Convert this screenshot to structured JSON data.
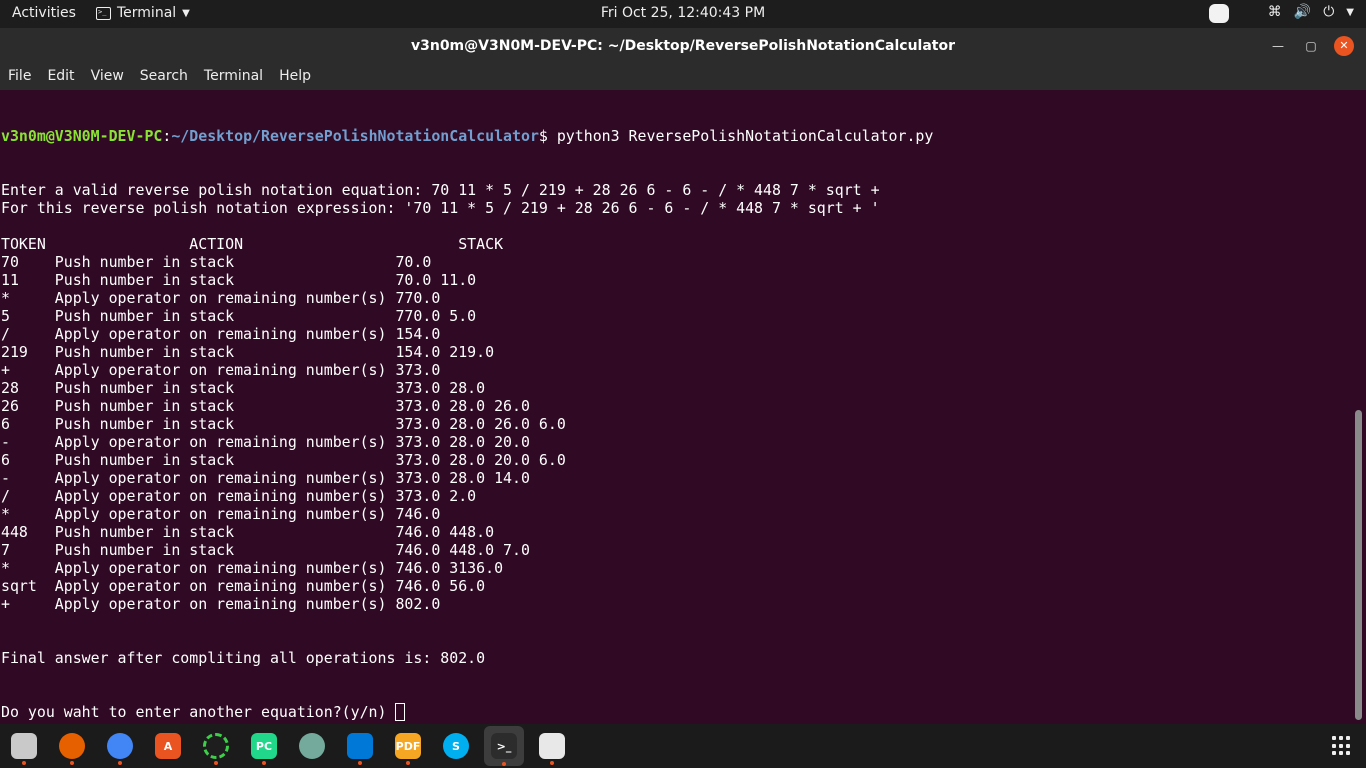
{
  "topbar": {
    "activities": "Activities",
    "app_name": "Terminal",
    "clock": "Fri Oct 25, 12:40:43 PM"
  },
  "window": {
    "title": "v3n0m@V3N0M-DEV-PC: ~/Desktop/ReversePolishNotationCalculator"
  },
  "menubar": [
    "File",
    "Edit",
    "View",
    "Search",
    "Terminal",
    "Help"
  ],
  "terminal": {
    "prompt_user": "v3n0m@V3N0M-DEV-PC",
    "prompt_path": "~/Desktop/ReversePolishNotationCalculator",
    "command": "$ python3 ReversePolishNotationCalculator.py",
    "output": [
      "Enter a valid reverse polish notation equation: 70 11 * 5 / 219 + 28 26 6 - 6 - / * 448 7 * sqrt +",
      "For this reverse polish notation expression: '70 11 * 5 / 219 + 28 26 6 - 6 - / * 448 7 * sqrt + '",
      "",
      "TOKEN                ACTION                        STACK",
      "70    Push number in stack                  70.0",
      "11    Push number in stack                  70.0 11.0",
      "*     Apply operator on remaining number(s) 770.0",
      "5     Push number in stack                  770.0 5.0",
      "/     Apply operator on remaining number(s) 154.0",
      "219   Push number in stack                  154.0 219.0",
      "+     Apply operator on remaining number(s) 373.0",
      "28    Push number in stack                  373.0 28.0",
      "26    Push number in stack                  373.0 28.0 26.0",
      "6     Push number in stack                  373.0 28.0 26.0 6.0",
      "-     Apply operator on remaining number(s) 373.0 28.0 20.0",
      "6     Push number in stack                  373.0 28.0 20.0 6.0",
      "-     Apply operator on remaining number(s) 373.0 28.0 14.0",
      "/     Apply operator on remaining number(s) 373.0 2.0",
      "*     Apply operator on remaining number(s) 746.0",
      "448   Push number in stack                  746.0 448.0",
      "7     Push number in stack                  746.0 448.0 7.0",
      "*     Apply operator on remaining number(s) 746.0 3136.0",
      "sqrt  Apply operator on remaining number(s) 746.0 56.0",
      "+     Apply operator on remaining number(s) 802.0",
      "",
      "",
      "Final answer after compliting all operations is: 802.0",
      "",
      "",
      "Do you waht to enter another equation?(y/n) "
    ]
  },
  "dock": [
    {
      "name": "files",
      "label": "",
      "color": "#c9c9c9"
    },
    {
      "name": "firefox",
      "label": "",
      "color": "#e66000"
    },
    {
      "name": "chrome",
      "label": "",
      "color": "#4285f4"
    },
    {
      "name": "software",
      "label": "A",
      "color": "#e95420"
    },
    {
      "name": "loader",
      "label": "",
      "color": "#1e1e1e"
    },
    {
      "name": "pycharm",
      "label": "PC",
      "color": "#21d789"
    },
    {
      "name": "chatgpt",
      "label": "",
      "color": "#74aa9c"
    },
    {
      "name": "vscode",
      "label": "",
      "color": "#0078d7"
    },
    {
      "name": "pdf",
      "label": "PDF",
      "color": "#f5a623"
    },
    {
      "name": "skype",
      "label": "S",
      "color": "#00aff0"
    },
    {
      "name": "terminal",
      "label": ">_",
      "color": "#2c2c2c"
    },
    {
      "name": "text-editor",
      "label": "",
      "color": "#e8e8e8"
    }
  ]
}
